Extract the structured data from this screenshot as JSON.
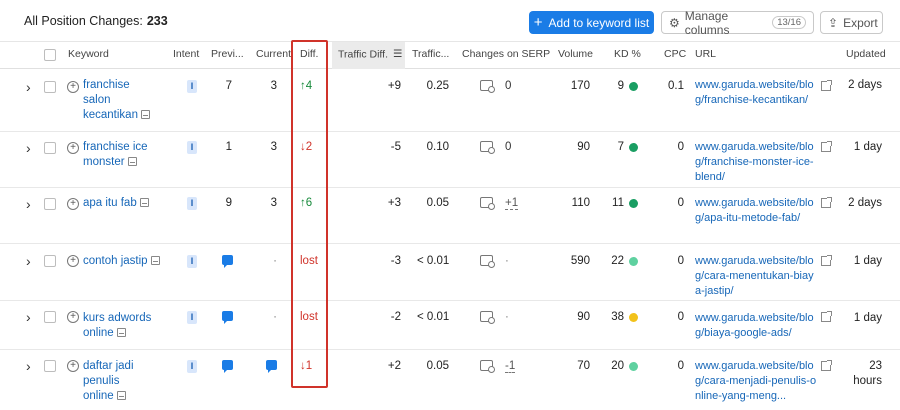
{
  "header": {
    "title_prefix": "All Position Changes:",
    "count": "233",
    "add_button": "Add to keyword list",
    "manage_button": "Manage columns",
    "manage_badge": "13/16",
    "export_button": "Export"
  },
  "columns": {
    "keyword": "Keyword",
    "intent": "Intent",
    "previous": "Previ...",
    "current": "Current",
    "diff": "Diff.",
    "traffic_diff": "Traffic Diff.",
    "traffic": "Traffic...",
    "serp_changes": "Changes on SERP",
    "volume": "Volume",
    "kd": "KD %",
    "cpc": "CPC",
    "url": "URL",
    "updated": "Updated"
  },
  "colors": {
    "accent": "#1a7ce6",
    "up": "#178a3b",
    "down": "#d0332a",
    "kd_green": "#1a9e63",
    "kd_light_green": "#5fd1a0",
    "kd_yellow": "#f2c21b",
    "highlight": "#d0332a"
  },
  "rows": [
    {
      "keyword": "franchise salon kecantikan",
      "intent": "I",
      "previous": "7",
      "current": "3",
      "diff": "↑4",
      "traffic_diff": "+9",
      "traffic": "0.25",
      "serp": "0",
      "volume": "170",
      "kd": "9",
      "cpc": "0.1",
      "url": "www.garuda.website/blog/franchise-kecantikan/",
      "updated": "2 days"
    },
    {
      "keyword": "franchise ice monster",
      "intent": "I",
      "previous": "1",
      "current": "3",
      "diff": "↓2",
      "traffic_diff": "-5",
      "traffic": "0.10",
      "serp": "0",
      "volume": "90",
      "kd": "7",
      "cpc": "0",
      "url": "www.garuda.website/blog/franchise-monster-ice-blend/",
      "updated": "1 day"
    },
    {
      "keyword": "apa itu fab",
      "intent": "I",
      "previous": "9",
      "current": "3",
      "diff": "↑6",
      "traffic_diff": "+3",
      "traffic": "0.05",
      "serp": "+1",
      "volume": "110",
      "kd": "11",
      "cpc": "0",
      "url": "www.garuda.website/blog/apa-itu-metode-fab/",
      "updated": "2 days"
    },
    {
      "keyword": "contoh jastip",
      "intent": "I",
      "previous": "",
      "current": "·",
      "diff": "lost",
      "traffic_diff": "-3",
      "traffic": "< 0.01",
      "serp": "·",
      "volume": "590",
      "kd": "22",
      "cpc": "0",
      "url": "www.garuda.website/blog/cara-menentukan-biaya-jastip/",
      "updated": "1 day"
    },
    {
      "keyword": "kurs adwords online",
      "intent": "I",
      "previous": "",
      "current": "·",
      "diff": "lost",
      "traffic_diff": "-2",
      "traffic": "< 0.01",
      "serp": "·",
      "volume": "90",
      "kd": "38",
      "cpc": "0",
      "url": "www.garuda.website/blog/biaya-google-ads/",
      "updated": "1 day"
    },
    {
      "keyword": "daftar jadi penulis online",
      "intent": "I",
      "previous": "",
      "current": "",
      "diff": "↓1",
      "traffic_diff": "+2",
      "traffic": "0.05",
      "serp": "-1",
      "volume": "70",
      "kd": "20",
      "cpc": "0",
      "url": "www.garuda.website/blog/cara-menjadi-penulis-online-yang-meng...",
      "updated": "23 hours"
    }
  ]
}
